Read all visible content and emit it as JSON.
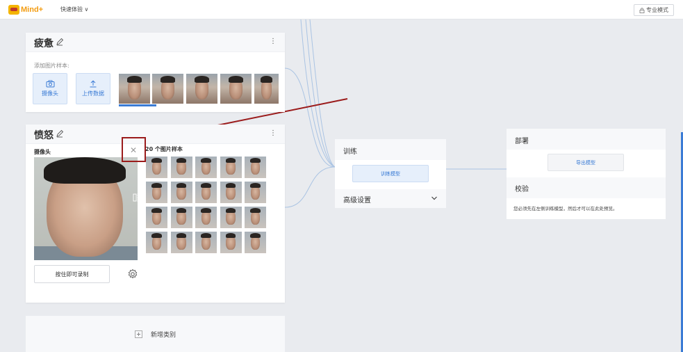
{
  "topbar": {
    "logo_text": "Mind+",
    "quick_label": "快速体验 ∨",
    "pro_label": "专业模式"
  },
  "class1": {
    "title": "疲惫",
    "add_samples_label": "添加图片样本:",
    "webcam_label": "摄像头",
    "upload_label": "上传数据"
  },
  "class2": {
    "title": "愤怒",
    "camera_label": "摄像头",
    "samples_count_label": "20 个图片样本",
    "record_label": "按住即可录制"
  },
  "add_class_label": "新增类别",
  "training": {
    "title": "训练",
    "train_button": "训练模型",
    "advanced_label": "高级设置"
  },
  "deploy": {
    "title": "部署",
    "export_button": "导出模型",
    "verify_title": "校验",
    "verify_text": "您必须先在左侧训练模型，然后才可以在此处预览。"
  },
  "colors": {
    "accent": "#3a7bd5",
    "annotation": "#9b1b1b",
    "logo": "#f39c12"
  }
}
